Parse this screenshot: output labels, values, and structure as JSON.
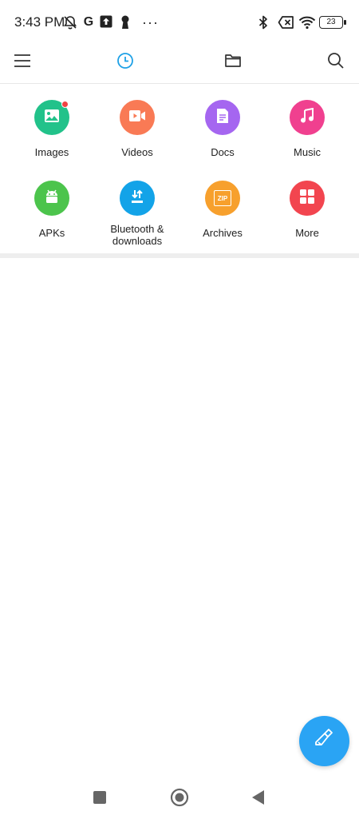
{
  "status_bar": {
    "time": "3:43 PM",
    "left_icons": [
      "notifications-off-icon",
      "google-icon",
      "upload-icon",
      "keyhole-icon",
      "more-dots-icon"
    ],
    "g_letter": "G",
    "dots": "···",
    "right_icons": [
      "bluetooth-icon",
      "no-sim-icon",
      "wifi-icon",
      "battery-icon"
    ],
    "battery_level": "23"
  },
  "toolbar": {
    "icons": [
      "menu-icon",
      "recent-clock-icon",
      "folder-icon",
      "search-icon"
    ],
    "active_color": "#1ea1e6"
  },
  "categories": [
    {
      "label": "Images",
      "icon": "image-icon",
      "color": "#22c28a",
      "badge": true
    },
    {
      "label": "Videos",
      "icon": "video-icon",
      "color": "#f97a55",
      "badge": false
    },
    {
      "label": "Docs",
      "icon": "document-icon",
      "color": "#a566f0",
      "badge": false
    },
    {
      "label": "Music",
      "icon": "music-icon",
      "color": "#f0408f",
      "badge": false
    },
    {
      "label": "APKs",
      "icon": "android-icon",
      "color": "#4cc44c",
      "badge": false
    },
    {
      "label": "Bluetooth & downloads",
      "icon": "download-icon",
      "color": "#13a3e8",
      "badge": false
    },
    {
      "label": "Archives",
      "icon": "zip-icon",
      "color": "#f7a02d",
      "badge": false
    },
    {
      "label": "More",
      "icon": "grid-icon",
      "color": "#f2454f",
      "badge": false
    }
  ],
  "category_label_lines": {
    "bluetooth_line1": "Bluetooth &",
    "bluetooth_line2": "downloads"
  },
  "zip_text": "ZIP",
  "fab": {
    "icon": "cleaner-brush-icon",
    "color": "#2aa4f4"
  },
  "nav_bar": {
    "icons": [
      "recents-square-icon",
      "home-circle-icon",
      "back-triangle-icon"
    ]
  }
}
